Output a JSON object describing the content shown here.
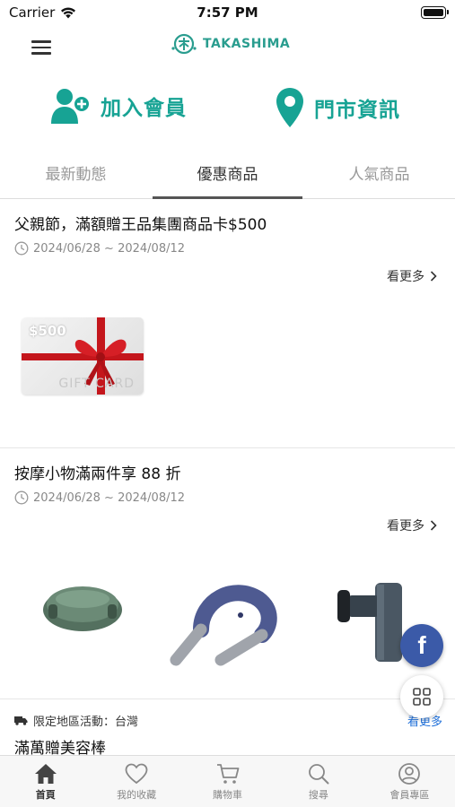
{
  "status_bar": {
    "carrier": "Carrier",
    "time": "7:57 PM"
  },
  "header": {
    "logo_text": "TAKASHIMA",
    "brand_color": "#2a9d8f"
  },
  "quick_actions": {
    "member": {
      "label": "加入會員",
      "icon": "add-user-icon"
    },
    "store": {
      "label": "門市資訊",
      "icon": "location-pin-icon"
    },
    "accent_color": "#17a394"
  },
  "tabs": [
    {
      "label": "最新動態",
      "active": false
    },
    {
      "label": "優惠商品",
      "active": true
    },
    {
      "label": "人氣商品",
      "active": false
    }
  ],
  "promotions": [
    {
      "title": "父親節，滿額贈王品集團商品卡$500",
      "date": "2024/06/28 ~ 2024/08/12",
      "see_more": "看更多",
      "gift_card": {
        "amount": "$500",
        "text": "GIFT CARD"
      }
    },
    {
      "title": "按摩小物滿兩件享 88 折",
      "date": "2024/06/28 ~ 2024/08/12",
      "see_more": "看更多"
    },
    {
      "region_label": "限定地區活動：台灣",
      "see_more": "看更多",
      "title": "滿萬贈美容棒"
    }
  ],
  "floating": {
    "facebook_letter": "f"
  },
  "bottom_nav": [
    {
      "label": "首頁",
      "icon": "home-icon",
      "active": true
    },
    {
      "label": "我的收藏",
      "icon": "heart-icon",
      "active": false
    },
    {
      "label": "購物車",
      "icon": "cart-icon",
      "active": false
    },
    {
      "label": "搜尋",
      "icon": "search-icon",
      "active": false
    },
    {
      "label": "會員專區",
      "icon": "user-circle-icon",
      "active": false
    }
  ]
}
